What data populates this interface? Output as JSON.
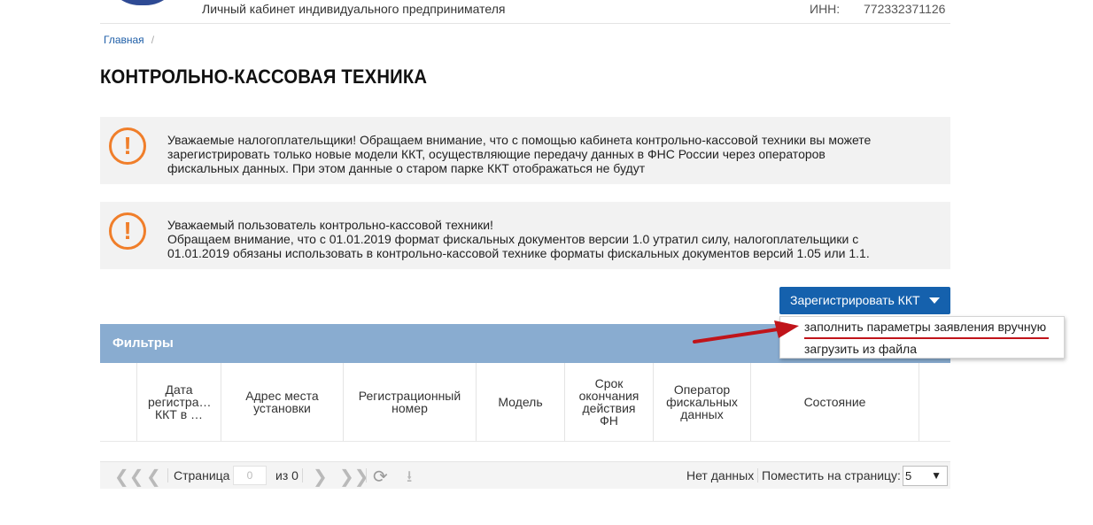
{
  "header": {
    "cabinet_title": "Личный кабинет индивидуального предпринимателя",
    "inn_label": "ИНН:",
    "inn_value": "772332371126"
  },
  "breadcrumb": {
    "home": "Главная",
    "separator": "/"
  },
  "page_title": "КОНТРОЛЬНО-КАССОВАЯ ТЕХНИКА",
  "notices": [
    {
      "icon": "exclamation-icon",
      "lines": [
        "Уважаемые налогоплательщики! Обращаем внимание, что с помощью кабинета контрольно-кассовой техники вы можете",
        "зарегистрировать только новые модели ККТ, осуществляющие передачу данных в ФНС России через операторов",
        "фискальных данных. При этом данные о старом парке ККТ отображаться не будут"
      ]
    },
    {
      "icon": "exclamation-icon",
      "lines": [
        "Уважаемый пользователь контрольно-кассовой техники!",
        "Обращаем внимание, что с 01.01.2019 формат фискальных документов версии 1.0 утратил силу, налогоплательщики с",
        "01.01.2019 обязаны использовать в контрольно-кассовой технике форматы фискальных документов версий 1.05 или 1.1."
      ]
    }
  ],
  "register_button": {
    "label": "Зарегистрировать ККТ"
  },
  "register_menu": {
    "items": [
      "заполнить параметры заявления вручную",
      "загрузить из файла"
    ]
  },
  "filters": {
    "title": "Фильтры"
  },
  "table": {
    "columns": [
      "",
      "Дата регистра… ККТ в …",
      "Адрес места установки",
      "Регистрационный номер",
      "Модель",
      "Срок окончания действия ФН",
      "Оператор фискальных данных",
      "Состояние"
    ],
    "rows": []
  },
  "pager": {
    "page_label": "Страница",
    "page_value": "0",
    "of_label": "из 0",
    "status": "Нет данных",
    "per_page_label": "Поместить на страницу:",
    "per_page_value": "5"
  },
  "colors": {
    "accent": "#1561ad",
    "filters_bar": "#89acd0",
    "warning": "#f07e2a",
    "annotation": "#c0141a"
  }
}
